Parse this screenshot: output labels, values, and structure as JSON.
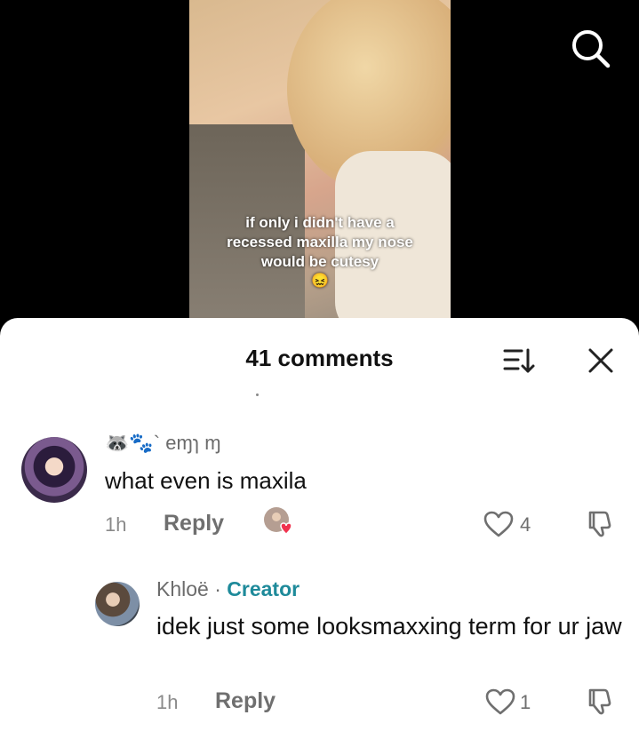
{
  "video": {
    "caption": "if only i didn't have a recessed maxilla my nose would be cutesy",
    "caption_emoji": "😖",
    "search_icon": "search-icon"
  },
  "comments_sheet": {
    "title": "41 comments",
    "sort_icon": "sort-icon",
    "close_icon": "close-icon",
    "comments": [
      {
        "username": "🦝🐾` eɱɿ ɱ",
        "text": "what even is maxila",
        "time": "1h",
        "reply_label": "Reply",
        "likes": "4",
        "creator_liked": true
      }
    ],
    "replies": [
      {
        "username": "Khloë",
        "separator": " · ",
        "badge": "Creator",
        "text": "idek just some looksmaxxing term for ur jaw",
        "time": "1h",
        "reply_label": "Reply",
        "likes": "1"
      }
    ]
  },
  "colors": {
    "creator_badge": "#1e8a9a",
    "liked_heart": "#f0334f"
  }
}
